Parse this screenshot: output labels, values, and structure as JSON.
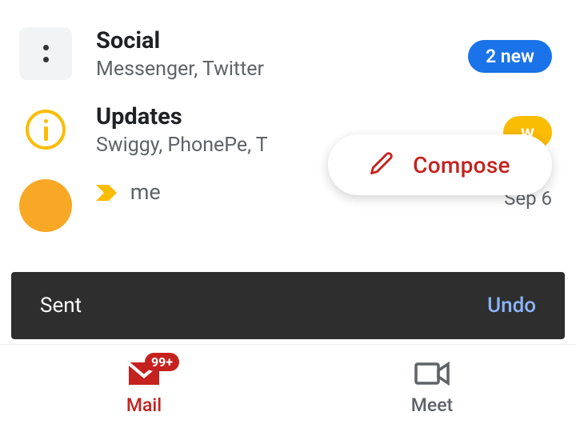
{
  "categories": {
    "social": {
      "title": "Social",
      "subtitle": "Messenger, Twitter",
      "badge": "2 new"
    },
    "updates": {
      "title": "Updates",
      "subtitle": "Swiggy, PhonePe, T",
      "badge": "w"
    }
  },
  "thread": {
    "sender": "me",
    "date": "Sep 6"
  },
  "compose": {
    "label": "Compose"
  },
  "snackbar": {
    "text": "Sent",
    "action": "Undo"
  },
  "nav": {
    "mail": {
      "label": "Mail",
      "count": "99+"
    },
    "meet": {
      "label": "Meet"
    }
  }
}
